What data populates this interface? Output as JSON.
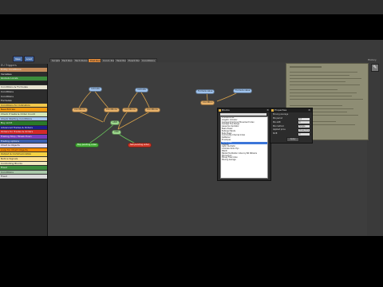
{
  "toolbar": {
    "btn1": "New",
    "btn2": "Load"
  },
  "tabs": [
    {
      "label": "Scripts"
    },
    {
      "label": "Fact Runner"
    },
    {
      "label": "Tech Runner"
    },
    {
      "label": "Post Runner"
    },
    {
      "label": "Cond. Runner"
    },
    {
      "label": "Task Runner"
    },
    {
      "label": "Event Runner"
    },
    {
      "label": "Conditions"
    }
  ],
  "history_label": "History",
  "tree": {
    "title": "EU Triggers",
    "items": [
      {
        "label": "Entity Conditions",
        "color": "#c38a5a"
      },
      {
        "label": "Variables",
        "color": "#2d2d2d"
      },
      {
        "label": "Globals     Locals",
        "color": "#3c8c3c"
      },
      {
        "label": "",
        "color": "#222222"
      },
      {
        "label": "Conditions & Formulas",
        "color": "#e7e3d0"
      },
      {
        "label": "Conditions",
        "color": "#2d2d2d"
      },
      {
        "label": "Conditions",
        "color": "#2d2d2d"
      },
      {
        "label": "Formulas",
        "color": "#2d2d2d"
      },
      {
        "label": "Conditions for Indicators",
        "color": "#f2c94c"
      },
      {
        "label": "New Entries",
        "color": "#f39c12"
      },
      {
        "label": "Check if Gate & Order Count",
        "color": "#d5e8b8"
      },
      {
        "label": "Check Starting Conditions",
        "color": "#a9c8ef"
      },
      {
        "label": "Buy Limit",
        "color": "#2a7a2a"
      },
      {
        "label": "Advanced Trades & Orders",
        "color": "#1e1e8c"
      },
      {
        "label": "Orders for Trades & Orders",
        "color": "#d62a2a"
      },
      {
        "label": "Trailing Stop / Break Even",
        "color": "#7a3fbf"
      },
      {
        "label": "Trading options",
        "color": "#3a5fb0"
      },
      {
        "label": "Chart & Objects",
        "color": "#e3d9f0"
      },
      {
        "label": "Loop for Chart Objects",
        "color": "#ff8c00"
      },
      {
        "label": "Output & Communication",
        "color": "#f5d142"
      },
      {
        "label": "Notice Signals",
        "color": "#ffe08a"
      },
      {
        "label": "Controlling Blocks",
        "color": "#f0e8c0"
      },
      {
        "label": "Fixed",
        "color": "#3d8c3d"
      },
      {
        "label": "Conditions",
        "color": "#a9c8a9"
      },
      {
        "label": "Fixed",
        "color": "#d8d8d8"
      }
    ]
  },
  "nodes": [
    {
      "label": "Indicator",
      "color": "blue"
    },
    {
      "label": "Indicator",
      "color": "blue"
    },
    {
      "label": "Conditions",
      "color": "orange"
    },
    {
      "label": "Conditions",
      "color": "orange"
    },
    {
      "label": "Conditions",
      "color": "orange"
    },
    {
      "label": "Conditions",
      "color": "orange"
    },
    {
      "label": "AND",
      "color": "green"
    },
    {
      "label": "AND",
      "color": "green"
    },
    {
      "label": "Buy pending order",
      "color": "dgreen"
    },
    {
      "label": "Sell pending order",
      "color": "red"
    },
    {
      "label": "Formula value",
      "color": "blue"
    },
    {
      "label": "Formula value",
      "color": "blue"
    },
    {
      "label": "Condition",
      "color": "orange"
    }
  ],
  "dialog_blocks": {
    "title": "Blocks",
    "items": [
      "Indicators List",
      "Alligator Indicator",
      "Average Directional Movement Index",
      "Average True Range",
      "Awesome Oscillator",
      "Bears Power",
      "Bollinger Bands",
      "Bulls Power",
      "Commodity Channel Index",
      "DeMarker",
      "Envelopes",
      "Force Index",
      "Fractals",
      "Gator Oscillator",
      "Ichimoku Kinko Hyo",
      "MACD",
      "Market Facilitation Index by Bill Williams",
      "Momentum",
      "Money Flow Index",
      "Moving Average"
    ],
    "selected": 11
  },
  "dialog_props": {
    "title": "Properties",
    "header": "Moving Average",
    "rows": [
      {
        "label": "MA period",
        "value": "14"
      },
      {
        "label": "MA shift",
        "value": "0"
      },
      {
        "label": "MA method",
        "value": "Simple"
      },
      {
        "label": "Applied price",
        "value": "Close price"
      },
      {
        "label": "Shift",
        "value": "0"
      }
    ],
    "button": "Apply"
  }
}
